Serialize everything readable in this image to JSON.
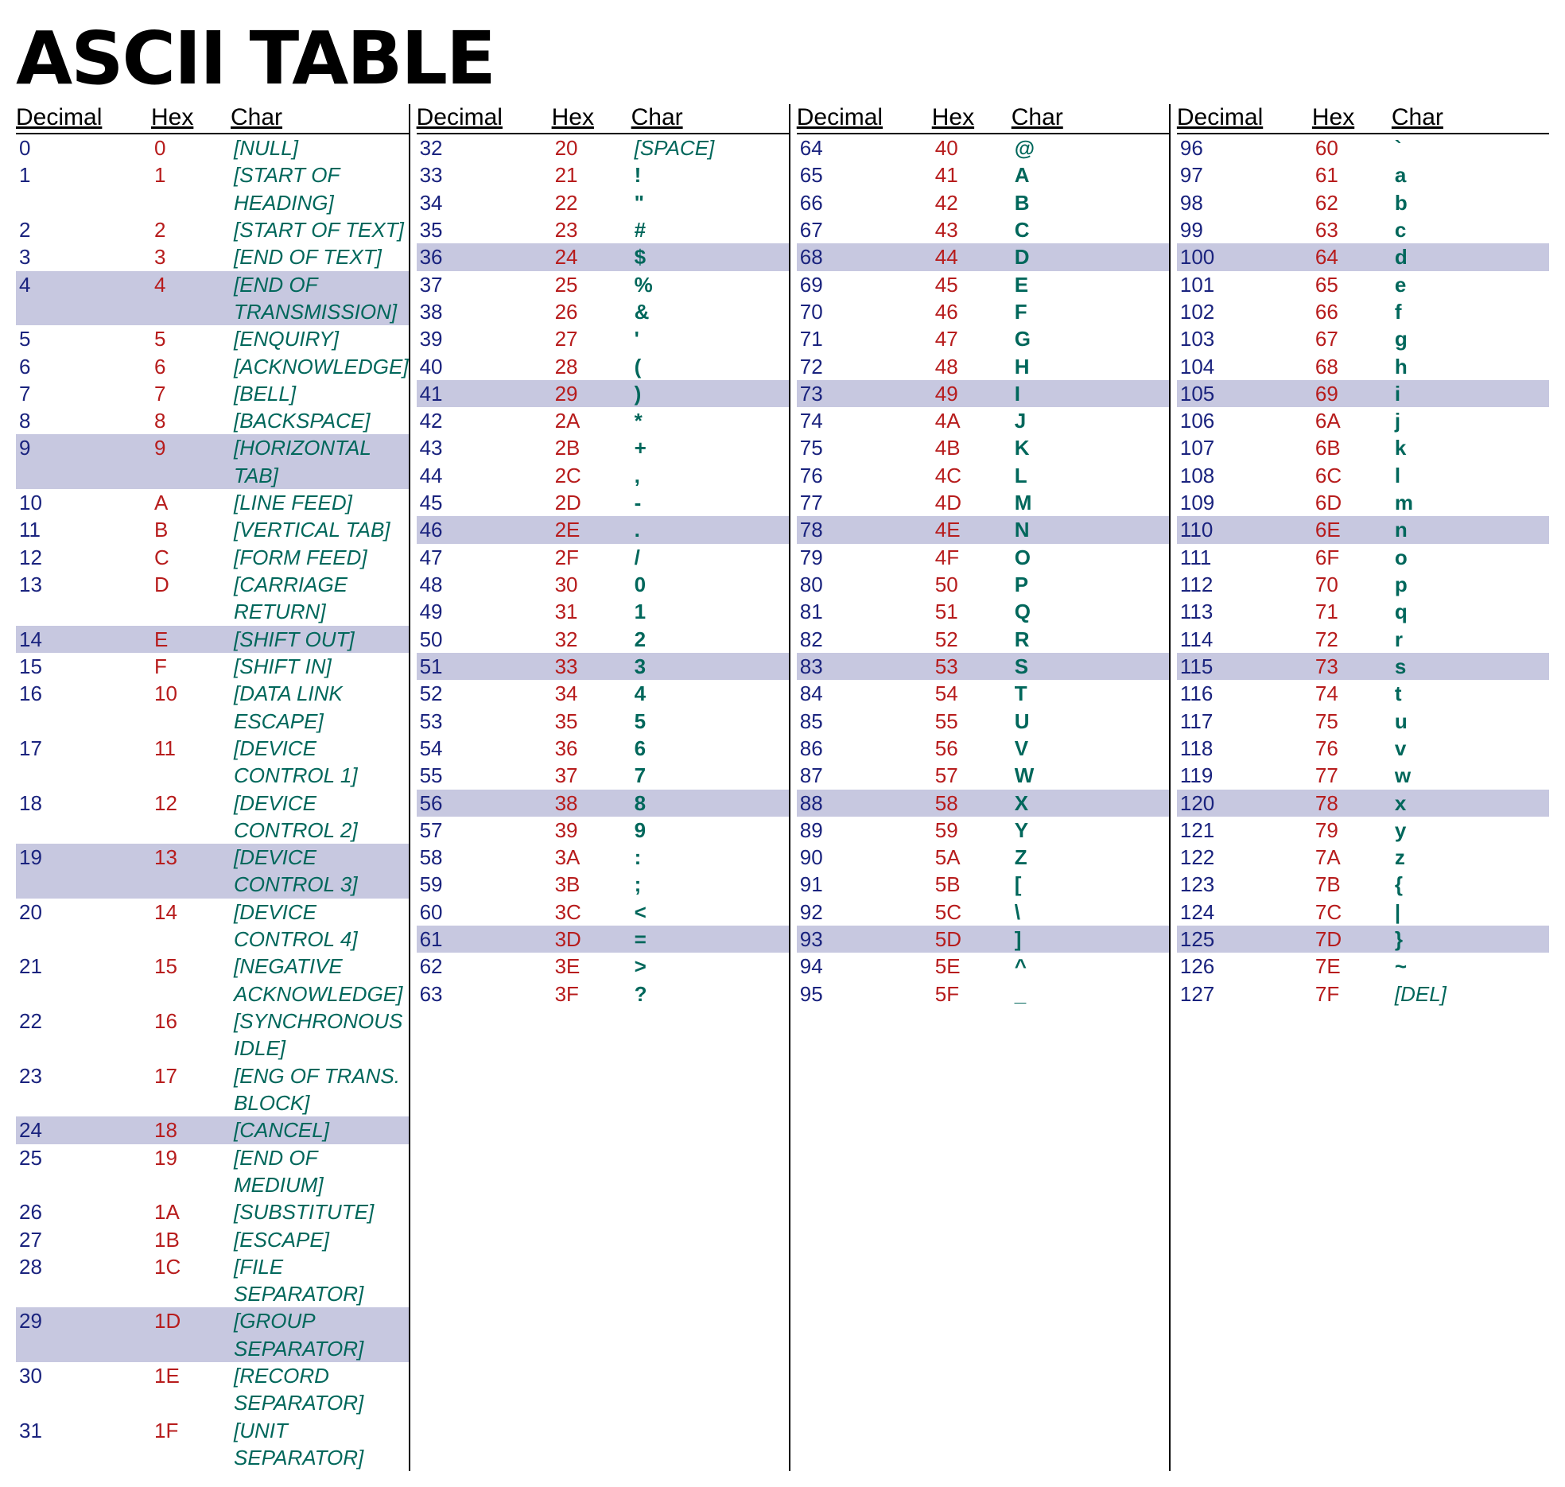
{
  "title": "ASCII TABLE",
  "headers": {
    "dec": "Decimal",
    "hex": "Hex",
    "char": "Char"
  },
  "columns": [
    [
      {
        "dec": "0",
        "hex": "0",
        "char": "[NULL]",
        "italic": true
      },
      {
        "dec": "1",
        "hex": "1",
        "char": "[START OF HEADING]",
        "italic": true
      },
      {
        "dec": "2",
        "hex": "2",
        "char": "[START OF TEXT]",
        "italic": true
      },
      {
        "dec": "3",
        "hex": "3",
        "char": "[END OF TEXT]",
        "italic": true
      },
      {
        "dec": "4",
        "hex": "4",
        "char": "[END OF TRANSMISSION]",
        "italic": true,
        "shaded": true
      },
      {
        "dec": "5",
        "hex": "5",
        "char": "[ENQUIRY]",
        "italic": true
      },
      {
        "dec": "6",
        "hex": "6",
        "char": "[ACKNOWLEDGE]",
        "italic": true
      },
      {
        "dec": "7",
        "hex": "7",
        "char": "[BELL]",
        "italic": true
      },
      {
        "dec": "8",
        "hex": "8",
        "char": "[BACKSPACE]",
        "italic": true
      },
      {
        "dec": "9",
        "hex": "9",
        "char": "[HORIZONTAL TAB]",
        "italic": true,
        "shaded": true
      },
      {
        "dec": "10",
        "hex": "A",
        "char": "[LINE FEED]",
        "italic": true
      },
      {
        "dec": "11",
        "hex": "B",
        "char": "[VERTICAL TAB]",
        "italic": true
      },
      {
        "dec": "12",
        "hex": "C",
        "char": "[FORM FEED]",
        "italic": true
      },
      {
        "dec": "13",
        "hex": "D",
        "char": "[CARRIAGE RETURN]",
        "italic": true
      },
      {
        "dec": "14",
        "hex": "E",
        "char": "[SHIFT OUT]",
        "italic": true,
        "shaded": true
      },
      {
        "dec": "15",
        "hex": "F",
        "char": "[SHIFT IN]",
        "italic": true
      },
      {
        "dec": "16",
        "hex": "10",
        "char": "[DATA LINK ESCAPE]",
        "italic": true
      },
      {
        "dec": "17",
        "hex": "11",
        "char": "[DEVICE CONTROL 1]",
        "italic": true
      },
      {
        "dec": "18",
        "hex": "12",
        "char": "[DEVICE CONTROL 2]",
        "italic": true
      },
      {
        "dec": "19",
        "hex": "13",
        "char": "[DEVICE CONTROL 3]",
        "italic": true,
        "shaded": true
      },
      {
        "dec": "20",
        "hex": "14",
        "char": "[DEVICE CONTROL 4]",
        "italic": true
      },
      {
        "dec": "21",
        "hex": "15",
        "char": "[NEGATIVE ACKNOWLEDGE]",
        "italic": true
      },
      {
        "dec": "22",
        "hex": "16",
        "char": "[SYNCHRONOUS IDLE]",
        "italic": true
      },
      {
        "dec": "23",
        "hex": "17",
        "char": "[ENG OF TRANS. BLOCK]",
        "italic": true
      },
      {
        "dec": "24",
        "hex": "18",
        "char": "[CANCEL]",
        "italic": true,
        "shaded": true
      },
      {
        "dec": "25",
        "hex": "19",
        "char": "[END OF MEDIUM]",
        "italic": true
      },
      {
        "dec": "26",
        "hex": "1A",
        "char": "[SUBSTITUTE]",
        "italic": true
      },
      {
        "dec": "27",
        "hex": "1B",
        "char": "[ESCAPE]",
        "italic": true
      },
      {
        "dec": "28",
        "hex": "1C",
        "char": "[FILE SEPARATOR]",
        "italic": true
      },
      {
        "dec": "29",
        "hex": "1D",
        "char": "[GROUP SEPARATOR]",
        "italic": true,
        "shaded": true
      },
      {
        "dec": "30",
        "hex": "1E",
        "char": "[RECORD SEPARATOR]",
        "italic": true
      },
      {
        "dec": "31",
        "hex": "1F",
        "char": "[UNIT SEPARATOR]",
        "italic": true
      }
    ],
    [
      {
        "dec": "32",
        "hex": "20",
        "char": "[SPACE]",
        "italic": true
      },
      {
        "dec": "33",
        "hex": "21",
        "char": "!"
      },
      {
        "dec": "34",
        "hex": "22",
        "char": "\""
      },
      {
        "dec": "35",
        "hex": "23",
        "char": "#"
      },
      {
        "dec": "36",
        "hex": "24",
        "char": "$",
        "shaded": true
      },
      {
        "dec": "37",
        "hex": "25",
        "char": "%"
      },
      {
        "dec": "38",
        "hex": "26",
        "char": "&"
      },
      {
        "dec": "39",
        "hex": "27",
        "char": "'"
      },
      {
        "dec": "40",
        "hex": "28",
        "char": "("
      },
      {
        "dec": "41",
        "hex": "29",
        "char": ")",
        "shaded": true
      },
      {
        "dec": "42",
        "hex": "2A",
        "char": "*"
      },
      {
        "dec": "43",
        "hex": "2B",
        "char": "+"
      },
      {
        "dec": "44",
        "hex": "2C",
        "char": ","
      },
      {
        "dec": "45",
        "hex": "2D",
        "char": "-"
      },
      {
        "dec": "46",
        "hex": "2E",
        "char": ".",
        "shaded": true
      },
      {
        "dec": "47",
        "hex": "2F",
        "char": "/"
      },
      {
        "dec": "48",
        "hex": "30",
        "char": "0"
      },
      {
        "dec": "49",
        "hex": "31",
        "char": "1"
      },
      {
        "dec": "50",
        "hex": "32",
        "char": "2"
      },
      {
        "dec": "51",
        "hex": "33",
        "char": "3",
        "shaded": true
      },
      {
        "dec": "52",
        "hex": "34",
        "char": "4"
      },
      {
        "dec": "53",
        "hex": "35",
        "char": "5"
      },
      {
        "dec": "54",
        "hex": "36",
        "char": "6"
      },
      {
        "dec": "55",
        "hex": "37",
        "char": "7"
      },
      {
        "dec": "56",
        "hex": "38",
        "char": "8",
        "shaded": true
      },
      {
        "dec": "57",
        "hex": "39",
        "char": "9"
      },
      {
        "dec": "58",
        "hex": "3A",
        "char": ":"
      },
      {
        "dec": "59",
        "hex": "3B",
        "char": ";"
      },
      {
        "dec": "60",
        "hex": "3C",
        "char": "<"
      },
      {
        "dec": "61",
        "hex": "3D",
        "char": "=",
        "shaded": true
      },
      {
        "dec": "62",
        "hex": "3E",
        "char": ">"
      },
      {
        "dec": "63",
        "hex": "3F",
        "char": "?"
      }
    ],
    [
      {
        "dec": "64",
        "hex": "40",
        "char": "@"
      },
      {
        "dec": "65",
        "hex": "41",
        "char": "A"
      },
      {
        "dec": "66",
        "hex": "42",
        "char": "B"
      },
      {
        "dec": "67",
        "hex": "43",
        "char": "C"
      },
      {
        "dec": "68",
        "hex": "44",
        "char": "D",
        "shaded": true
      },
      {
        "dec": "69",
        "hex": "45",
        "char": "E"
      },
      {
        "dec": "70",
        "hex": "46",
        "char": "F"
      },
      {
        "dec": "71",
        "hex": "47",
        "char": "G"
      },
      {
        "dec": "72",
        "hex": "48",
        "char": "H"
      },
      {
        "dec": "73",
        "hex": "49",
        "char": "I",
        "shaded": true
      },
      {
        "dec": "74",
        "hex": "4A",
        "char": "J"
      },
      {
        "dec": "75",
        "hex": "4B",
        "char": "K"
      },
      {
        "dec": "76",
        "hex": "4C",
        "char": "L"
      },
      {
        "dec": "77",
        "hex": "4D",
        "char": "M"
      },
      {
        "dec": "78",
        "hex": "4E",
        "char": "N",
        "shaded": true
      },
      {
        "dec": "79",
        "hex": "4F",
        "char": "O"
      },
      {
        "dec": "80",
        "hex": "50",
        "char": "P"
      },
      {
        "dec": "81",
        "hex": "51",
        "char": "Q"
      },
      {
        "dec": "82",
        "hex": "52",
        "char": "R"
      },
      {
        "dec": "83",
        "hex": "53",
        "char": "S",
        "shaded": true
      },
      {
        "dec": "84",
        "hex": "54",
        "char": "T"
      },
      {
        "dec": "85",
        "hex": "55",
        "char": "U"
      },
      {
        "dec": "86",
        "hex": "56",
        "char": "V"
      },
      {
        "dec": "87",
        "hex": "57",
        "char": "W"
      },
      {
        "dec": "88",
        "hex": "58",
        "char": "X",
        "shaded": true
      },
      {
        "dec": "89",
        "hex": "59",
        "char": "Y"
      },
      {
        "dec": "90",
        "hex": "5A",
        "char": "Z"
      },
      {
        "dec": "91",
        "hex": "5B",
        "char": "["
      },
      {
        "dec": "92",
        "hex": "5C",
        "char": "\\"
      },
      {
        "dec": "93",
        "hex": "5D",
        "char": "]",
        "shaded": true
      },
      {
        "dec": "94",
        "hex": "5E",
        "char": "^"
      },
      {
        "dec": "95",
        "hex": "5F",
        "char": "_"
      }
    ],
    [
      {
        "dec": "96",
        "hex": "60",
        "char": "`"
      },
      {
        "dec": "97",
        "hex": "61",
        "char": "a"
      },
      {
        "dec": "98",
        "hex": "62",
        "char": "b"
      },
      {
        "dec": "99",
        "hex": "63",
        "char": "c"
      },
      {
        "dec": "100",
        "hex": "64",
        "char": "d",
        "shaded": true
      },
      {
        "dec": "101",
        "hex": "65",
        "char": "e"
      },
      {
        "dec": "102",
        "hex": "66",
        "char": "f"
      },
      {
        "dec": "103",
        "hex": "67",
        "char": "g"
      },
      {
        "dec": "104",
        "hex": "68",
        "char": "h"
      },
      {
        "dec": "105",
        "hex": "69",
        "char": "i",
        "shaded": true
      },
      {
        "dec": "106",
        "hex": "6A",
        "char": "j"
      },
      {
        "dec": "107",
        "hex": "6B",
        "char": "k"
      },
      {
        "dec": "108",
        "hex": "6C",
        "char": "l"
      },
      {
        "dec": "109",
        "hex": "6D",
        "char": "m"
      },
      {
        "dec": "110",
        "hex": "6E",
        "char": "n",
        "shaded": true
      },
      {
        "dec": "111",
        "hex": "6F",
        "char": "o"
      },
      {
        "dec": "112",
        "hex": "70",
        "char": "p"
      },
      {
        "dec": "113",
        "hex": "71",
        "char": "q"
      },
      {
        "dec": "114",
        "hex": "72",
        "char": "r"
      },
      {
        "dec": "115",
        "hex": "73",
        "char": "s",
        "shaded": true
      },
      {
        "dec": "116",
        "hex": "74",
        "char": "t"
      },
      {
        "dec": "117",
        "hex": "75",
        "char": "u"
      },
      {
        "dec": "118",
        "hex": "76",
        "char": "v"
      },
      {
        "dec": "119",
        "hex": "77",
        "char": "w"
      },
      {
        "dec": "120",
        "hex": "78",
        "char": "x",
        "shaded": true
      },
      {
        "dec": "121",
        "hex": "79",
        "char": "y"
      },
      {
        "dec": "122",
        "hex": "7A",
        "char": "z"
      },
      {
        "dec": "123",
        "hex": "7B",
        "char": "{"
      },
      {
        "dec": "124",
        "hex": "7C",
        "char": "|"
      },
      {
        "dec": "125",
        "hex": "7D",
        "char": "}",
        "shaded": true
      },
      {
        "dec": "126",
        "hex": "7E",
        "char": "~"
      },
      {
        "dec": "127",
        "hex": "7F",
        "char": "[DEL]",
        "italic": true
      }
    ]
  ]
}
